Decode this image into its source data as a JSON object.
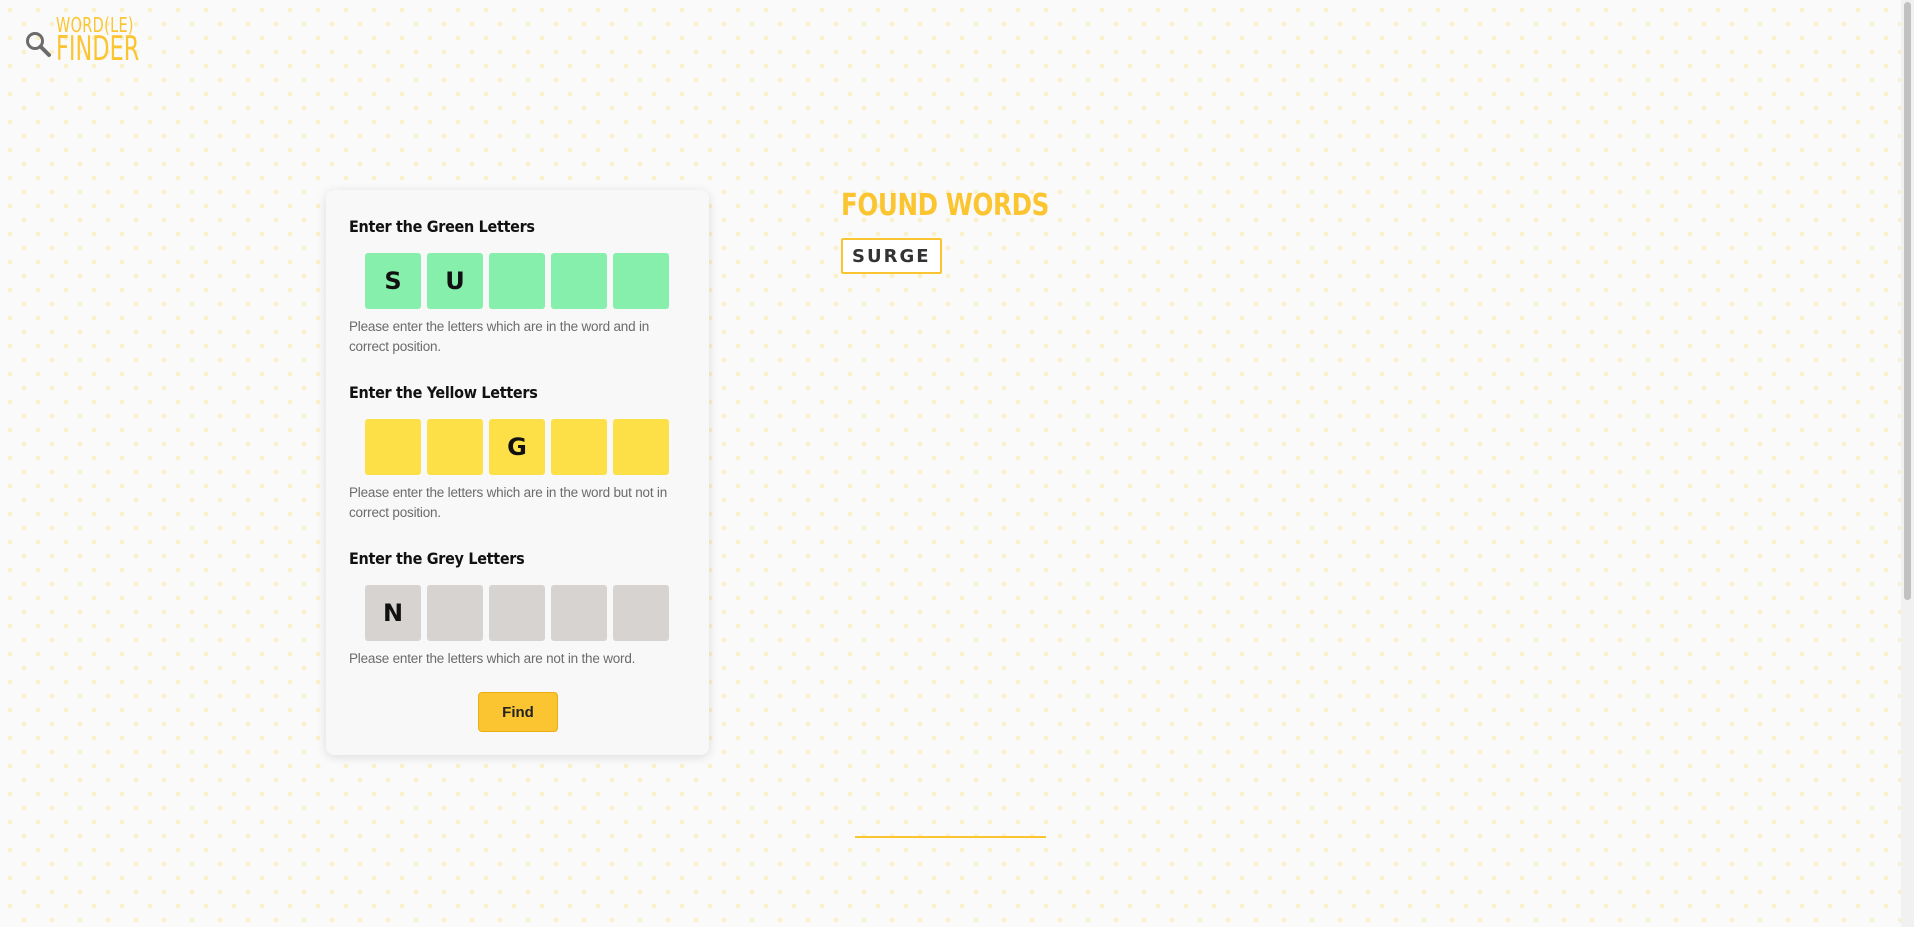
{
  "logo": {
    "line1": "WORD(LE)",
    "line2": "FINDER",
    "icon": "magnifier-icon"
  },
  "form": {
    "green": {
      "title": "Enter the Green Letters",
      "letters": [
        "S",
        "U",
        "",
        "",
        ""
      ],
      "hint": "Please enter the letters which are in the word and in correct position."
    },
    "yellow": {
      "title": "Enter the Yellow Letters",
      "letters": [
        "",
        "",
        "G",
        "",
        ""
      ],
      "hint": "Please enter the letters which are in the word but not in correct position."
    },
    "grey": {
      "title": "Enter the Grey Letters",
      "letters": [
        "N",
        "",
        "",
        "",
        ""
      ],
      "hint": "Please enter the letters which are not in the word."
    },
    "find_label": "Find"
  },
  "results": {
    "title": "FOUND WORDS",
    "words": [
      "SURGE"
    ]
  },
  "colors": {
    "accent": "#fbc531",
    "green_tile": "#86efac",
    "yellow_tile": "#fde047",
    "grey_tile": "#d6d3d1"
  }
}
